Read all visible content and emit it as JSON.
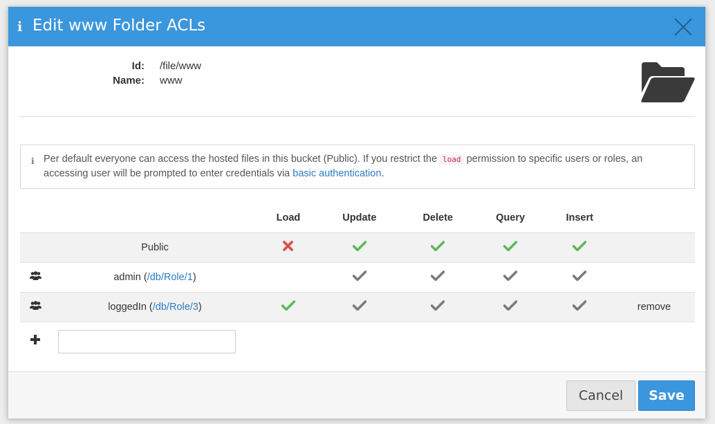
{
  "dialog": {
    "title": "Edit www Folder ACLs",
    "header_color": "#3a96dd"
  },
  "properties": {
    "id_label": "Id:",
    "id_value": "/file/www",
    "name_label": "Name:",
    "name_value": "www"
  },
  "alert": {
    "text_before": "Per default everyone can access the hosted files in this bucket (Public). If you restrict the",
    "code": "load",
    "text_middle": "permission to specific users or roles, an accessing user will be prompted to enter credentials via",
    "link": "basic authentication",
    "text_after": "."
  },
  "table": {
    "headers": [
      "Load",
      "Update",
      "Delete",
      "Query",
      "Insert"
    ],
    "rows": [
      {
        "name": "Public",
        "link": "",
        "load": "denied",
        "update": "allowed",
        "delete": "allowed",
        "query": "allowed",
        "insert": "allowed",
        "action": ""
      },
      {
        "name": "admin",
        "link": "/db/Role/1",
        "load": "none",
        "update": "inherited",
        "delete": "inherited",
        "query": "inherited",
        "insert": "inherited",
        "action": ""
      },
      {
        "name": "loggedIn",
        "link": "/db/Role/3",
        "load": "allowed",
        "update": "inherited",
        "delete": "inherited",
        "query": "inherited",
        "insert": "inherited",
        "action": "remove"
      }
    ]
  },
  "add_input": {
    "value": "",
    "placeholder": ""
  },
  "footer": {
    "cancel_label": "Cancel",
    "save_label": "Save"
  },
  "colors": {
    "allowed": "#5cb85c",
    "denied": "#d9534f",
    "inherited": "#7a7a7a",
    "link": "#2a7cc7"
  }
}
